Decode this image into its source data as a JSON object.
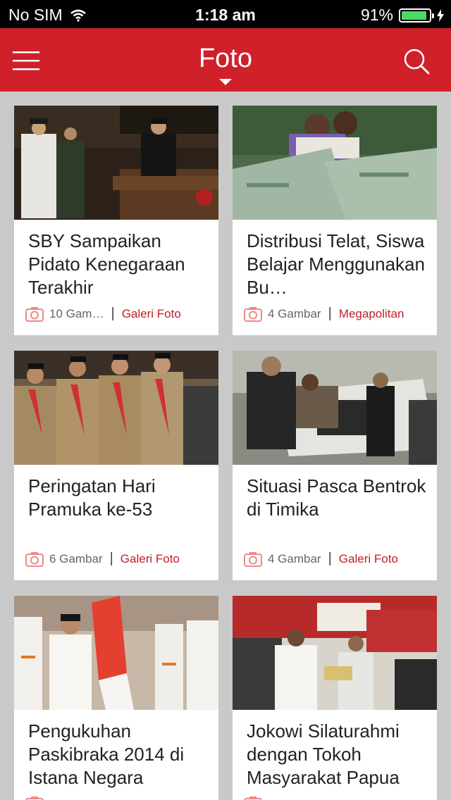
{
  "status_bar": {
    "carrier": "No SIM",
    "time": "1:18 am",
    "battery": "91%"
  },
  "navbar": {
    "title": "Foto"
  },
  "colors": {
    "accent": "#d0202a",
    "category_text": "#c0202a"
  },
  "cards": [
    {
      "title": "SBY Sampaikan Pidato Kenegaraan Terakhir",
      "count": "10 Gam…",
      "category": "Galeri Foto"
    },
    {
      "title": "Distribusi Telat, Siswa Belajar Menggunakan Bu…",
      "count": "4 Gambar",
      "category": "Megapolitan"
    },
    {
      "title": "Peringatan Hari Pramuka ke-53",
      "count": "6 Gambar",
      "category": "Galeri Foto"
    },
    {
      "title": "Situasi Pasca Bentrok di Timika",
      "count": "4 Gambar",
      "category": "Galeri Foto"
    },
    {
      "title": "Pengukuhan Paskibraka 2014 di Istana Negara",
      "count": "",
      "category": ""
    },
    {
      "title": "Jokowi Silaturahmi dengan Tokoh Masyarakat Papua",
      "count": "",
      "category": ""
    }
  ]
}
